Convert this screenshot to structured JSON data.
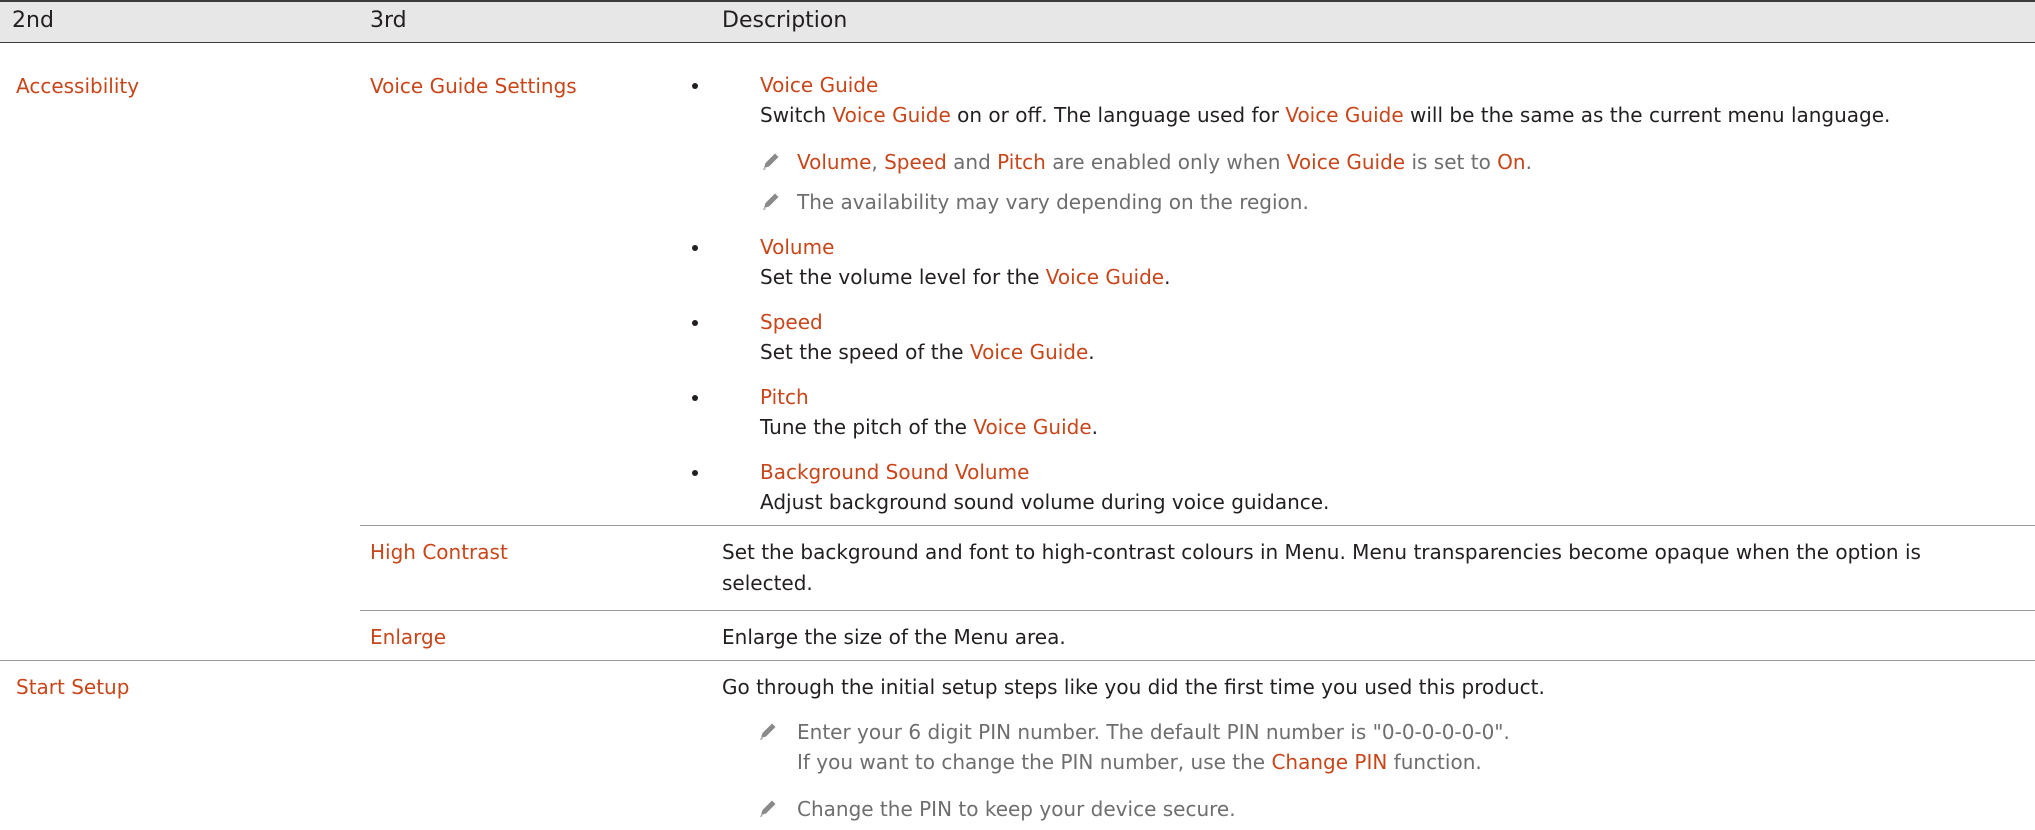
{
  "table": {
    "headers": [
      "2nd",
      "3rd",
      "Description"
    ],
    "accessibility": {
      "label": "Accessibility",
      "voice_guide_settings": {
        "label": "Voice Guide Settings",
        "voice_guide": {
          "title": "Voice Guide",
          "desc_1": "Switch ",
          "desc_link_1": "Voice Guide",
          "desc_2": " on or off. The language used for ",
          "desc_link_2": "Voice Guide",
          "desc_3": " will be the same as the current menu language.",
          "note_1": {
            "w1": "Volume",
            "s1": ", ",
            "w2": "Speed",
            "s2": " and ",
            "w3": "Pitch",
            "s3": " are enabled only when ",
            "w4": "Voice Guide",
            "s4": " is set to ",
            "w5": "On",
            "s5": "."
          },
          "note_2": "The availability may vary depending on the region."
        },
        "volume": {
          "title": "Volume",
          "desc": "Set the volume level for the ",
          "link": "Voice Guide",
          "end": "."
        },
        "speed": {
          "title": "Speed",
          "desc": "Set the speed of the ",
          "link": "Voice Guide",
          "end": "."
        },
        "pitch": {
          "title": "Pitch",
          "desc": "Tune the pitch of the ",
          "link": "Voice Guide",
          "end": "."
        },
        "background_sound": {
          "title": "Background Sound Volume",
          "desc": "Adjust background sound volume during voice guidance."
        }
      },
      "high_contrast": {
        "label": "High Contrast",
        "desc_line_1": "Set the background and font to high-contrast colours in Menu. Menu transparencies become opaque when the option is",
        "desc_line_2": "selected."
      },
      "enlarge": {
        "label": "Enlarge",
        "desc": "Enlarge the size of the Menu area."
      }
    },
    "start_setup": {
      "label": "Start Setup",
      "desc": "Go through the initial setup steps like you did the first time you used this product.",
      "note_1_line_1": "Enter your 6 digit PIN number. The default PIN number is \"0-0-0-0-0-0\".",
      "note_1_line_2_a": "If you want to change the PIN number, use the ",
      "note_1_line_2_link": "Change PIN",
      "note_1_line_2_b": " function.",
      "note_2": "Change the PIN to keep your device secure."
    }
  },
  "colors": {
    "accent": "#c8461a",
    "header_bg": "#e7e7e7",
    "note_text": "#6e6e6e"
  },
  "icons": {
    "note": "pencil-icon"
  }
}
